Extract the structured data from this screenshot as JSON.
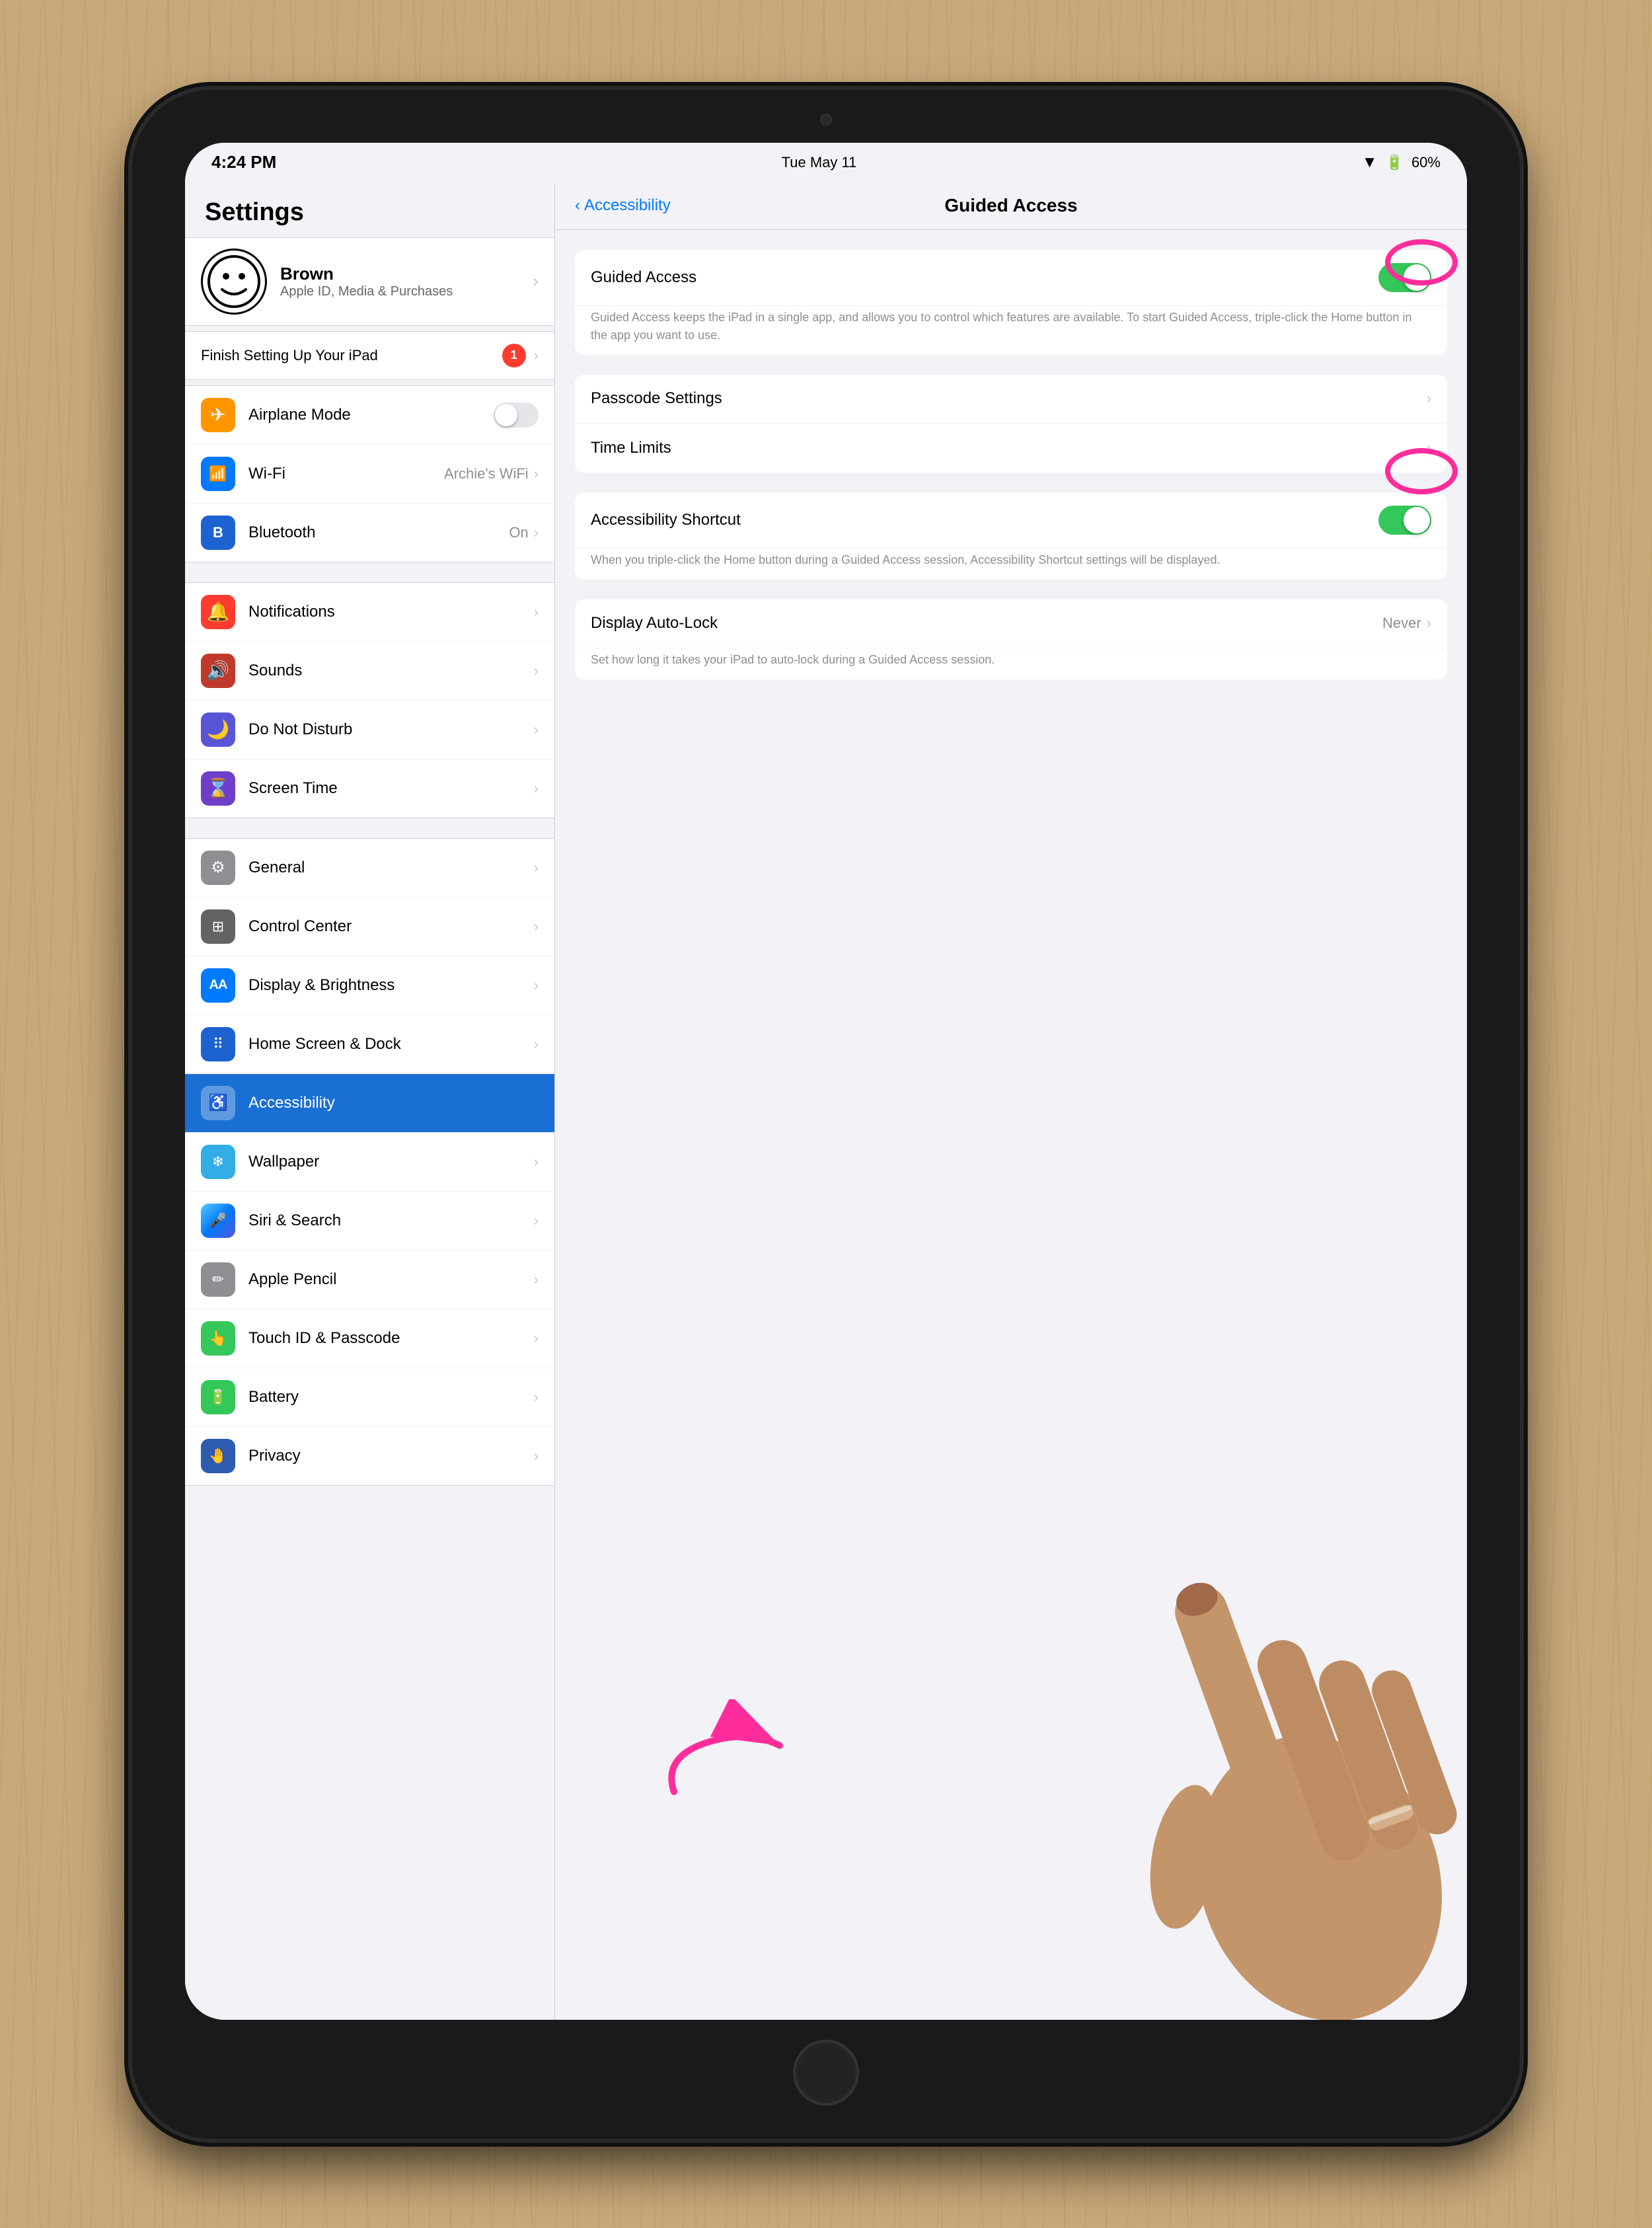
{
  "device": {
    "status_bar": {
      "time": "4:24 PM",
      "date": "Tue May 11",
      "wifi": "▼",
      "battery": "60%"
    }
  },
  "sidebar": {
    "title": "Settings",
    "profile": {
      "name": "Brown",
      "subtitle": "Apple ID, Media & Purchases"
    },
    "finish_setup": {
      "label": "Finish Setting Up Your iPad",
      "badge": "1"
    },
    "sections": [
      {
        "items": [
          {
            "id": "airplane",
            "icon": "✈",
            "icon_color": "icon-orange",
            "label": "Airplane Mode",
            "toggle": true
          },
          {
            "id": "wifi",
            "icon": "📶",
            "icon_color": "icon-blue",
            "label": "Wi-Fi",
            "value": "Archie's WiFi"
          },
          {
            "id": "bluetooth",
            "icon": "B",
            "icon_color": "icon-blue-dark",
            "label": "Bluetooth",
            "value": "On"
          }
        ]
      },
      {
        "items": [
          {
            "id": "notifications",
            "icon": "🔔",
            "icon_color": "icon-red",
            "label": "Notifications"
          },
          {
            "id": "sounds",
            "icon": "🔊",
            "icon_color": "icon-red-dark",
            "label": "Sounds"
          },
          {
            "id": "donotdisturb",
            "icon": "🌙",
            "icon_color": "icon-purple",
            "label": "Do Not Disturb"
          },
          {
            "id": "screentime",
            "icon": "⌛",
            "icon_color": "icon-purple-dark",
            "label": "Screen Time"
          }
        ]
      },
      {
        "items": [
          {
            "id": "general",
            "icon": "⚙",
            "icon_color": "icon-gray",
            "label": "General"
          },
          {
            "id": "controlcenter",
            "icon": "⊞",
            "icon_color": "icon-gray2",
            "label": "Control Center"
          },
          {
            "id": "displaybrightness",
            "icon": "AA",
            "icon_color": "icon-blue",
            "label": "Display & Brightness"
          },
          {
            "id": "homescreen",
            "icon": "⠿",
            "icon_color": "icon-blue-dark",
            "label": "Home Screen & Dock"
          },
          {
            "id": "accessibility",
            "icon": "♿",
            "icon_color": "icon-accessibility",
            "label": "Accessibility",
            "active": true
          },
          {
            "id": "wallpaper",
            "icon": "❄",
            "icon_color": "icon-teal",
            "label": "Wallpaper"
          },
          {
            "id": "sirisearch",
            "icon": "🌈",
            "icon_color": "icon-indigo",
            "label": "Siri & Search"
          },
          {
            "id": "applepencil",
            "icon": "✏",
            "icon_color": "icon-gray",
            "label": "Apple Pencil"
          },
          {
            "id": "touchid",
            "icon": "☁",
            "icon_color": "icon-green",
            "label": "Touch ID & Passcode"
          },
          {
            "id": "battery",
            "icon": "🔋",
            "icon_color": "icon-green",
            "label": "Battery"
          },
          {
            "id": "privacy",
            "icon": "🤚",
            "icon_color": "icon-blue",
            "label": "Privacy"
          }
        ]
      }
    ]
  },
  "right_panel": {
    "nav": {
      "back_label": "Accessibility",
      "title": "Guided Access"
    },
    "groups": [
      {
        "rows": [
          {
            "id": "guided-access",
            "label": "Guided Access",
            "toggle": true,
            "toggle_on": true,
            "description": "Guided Access keeps the iPad in a single app, and allows you to control which features are available. To start Guided Access, triple-click the Home button in the app you want to use."
          }
        ]
      },
      {
        "rows": [
          {
            "id": "passcode-settings",
            "label": "Passcode Settings",
            "chevron": true
          },
          {
            "id": "time-limits",
            "label": "Time Limits",
            "chevron": true
          }
        ]
      },
      {
        "rows": [
          {
            "id": "accessibility-shortcut",
            "label": "Accessibility Shortcut",
            "toggle": true,
            "toggle_on": true,
            "description": "When you triple-click the Home button during a Guided Access session, Accessibility Shortcut settings will be displayed."
          }
        ]
      },
      {
        "rows": [
          {
            "id": "display-auto-lock",
            "label": "Display Auto-Lock",
            "value": "Never",
            "chevron": true,
            "description": "Set how long it takes your iPad to auto-lock during a Guided Access session."
          }
        ]
      }
    ]
  }
}
